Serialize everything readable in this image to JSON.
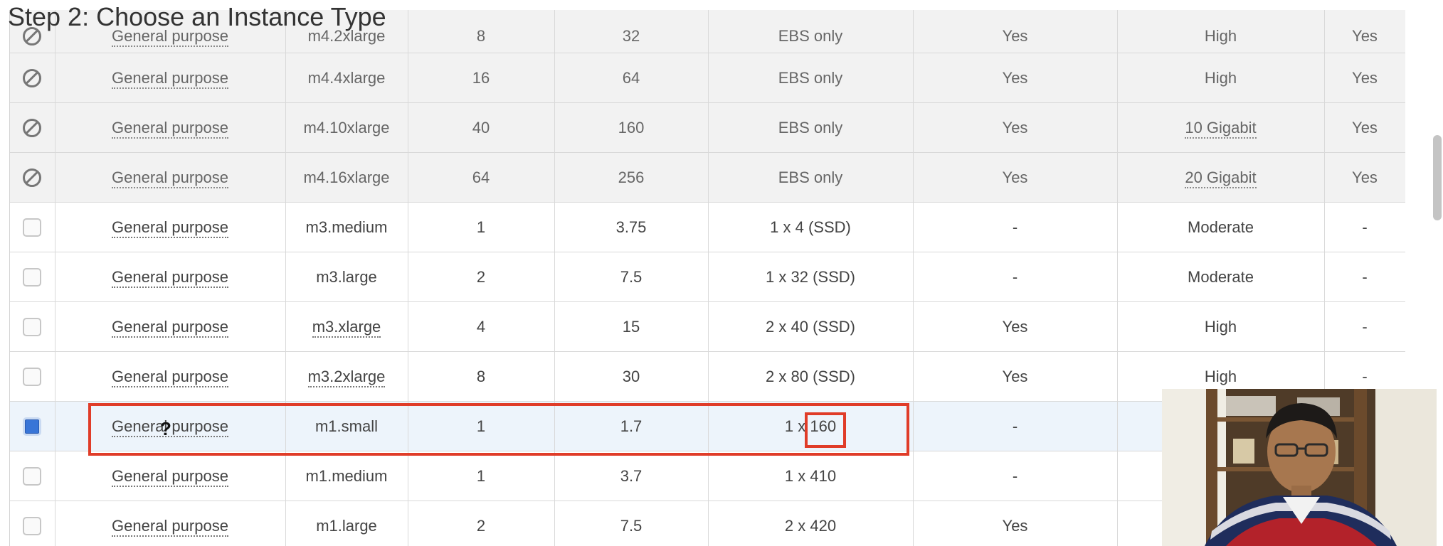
{
  "page": {
    "title": "Step 2: Choose an Instance Type"
  },
  "table": {
    "rows": [
      {
        "state": "disabled",
        "family": "General purpose",
        "type": "m4.2xlarge",
        "vcpus": "8",
        "memory": "32",
        "storage": "EBS only",
        "ebs_optimized": "Yes",
        "network": "High",
        "ipv6": "Yes"
      },
      {
        "state": "disabled",
        "family": "General purpose",
        "type": "m4.4xlarge",
        "vcpus": "16",
        "memory": "64",
        "storage": "EBS only",
        "ebs_optimized": "Yes",
        "network": "High",
        "ipv6": "Yes"
      },
      {
        "state": "disabled",
        "family": "General purpose",
        "type": "m4.10xlarge",
        "vcpus": "40",
        "memory": "160",
        "storage": "EBS only",
        "ebs_optimized": "Yes",
        "network": "10 Gigabit",
        "ipv6": "Yes"
      },
      {
        "state": "disabled",
        "family": "General purpose",
        "type": "m4.16xlarge",
        "vcpus": "64",
        "memory": "256",
        "storage": "EBS only",
        "ebs_optimized": "Yes",
        "network": "20 Gigabit",
        "ipv6": "Yes"
      },
      {
        "state": "unchecked",
        "family": "General purpose",
        "type": "m3.medium",
        "vcpus": "1",
        "memory": "3.75",
        "storage": "1 x 4 (SSD)",
        "ebs_optimized": "-",
        "network": "Moderate",
        "ipv6": "-"
      },
      {
        "state": "unchecked",
        "family": "General purpose",
        "type": "m3.large",
        "vcpus": "2",
        "memory": "7.5",
        "storage": "1 x 32 (SSD)",
        "ebs_optimized": "-",
        "network": "Moderate",
        "ipv6": "-"
      },
      {
        "state": "unchecked",
        "family": "General purpose",
        "type": "m3.xlarge",
        "vcpus": "4",
        "memory": "15",
        "storage": "2 x 40 (SSD)",
        "ebs_optimized": "Yes",
        "network": "High",
        "ipv6": "-"
      },
      {
        "state": "unchecked",
        "family": "General purpose",
        "type": "m3.2xlarge",
        "vcpus": "8",
        "memory": "30",
        "storage": "2 x 80 (SSD)",
        "ebs_optimized": "Yes",
        "network": "High",
        "ipv6": "-"
      },
      {
        "state": "checked",
        "family": "General purpose",
        "type": "m1.small",
        "vcpus": "1",
        "memory": "1.7",
        "storage": "1 x 160",
        "ebs_optimized": "-",
        "network": "",
        "ipv6": ""
      },
      {
        "state": "unchecked",
        "family": "General purpose",
        "type": "m1.medium",
        "vcpus": "1",
        "memory": "3.7",
        "storage": "1 x 410",
        "ebs_optimized": "-",
        "network": "",
        "ipv6": ""
      },
      {
        "state": "unchecked",
        "family": "General purpose",
        "type": "m1.large",
        "vcpus": "2",
        "memory": "7.5",
        "storage": "2 x 420",
        "ebs_optimized": "Yes",
        "network": "",
        "ipv6": ""
      }
    ]
  },
  "colors": {
    "annotation": "#e03c28",
    "checked": "#3875d7",
    "selected_row": "#edf4fb",
    "disabled_row": "#f2f2f2"
  },
  "cursor": {
    "glyph": "?"
  }
}
